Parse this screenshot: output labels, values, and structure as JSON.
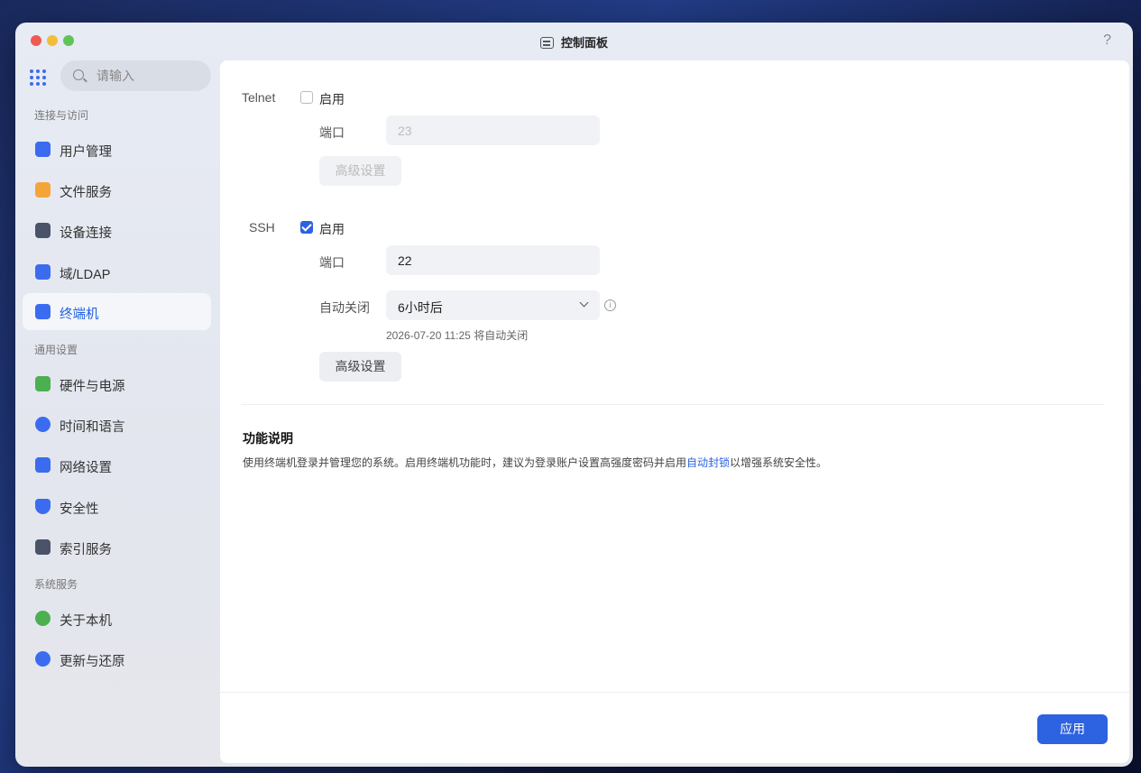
{
  "window": {
    "title": "控制面板",
    "help": "?"
  },
  "sidebar": {
    "search_placeholder": "请输入",
    "sections": [
      {
        "label": "连接与访问",
        "items": [
          {
            "label": "用户管理",
            "icon": "user-icon",
            "color": "#3b6cf0"
          },
          {
            "label": "文件服务",
            "icon": "folder-icon",
            "color": "#f3a53a"
          },
          {
            "label": "设备连接",
            "icon": "device-icon",
            "color": "#4a5368"
          },
          {
            "label": "域/LDAP",
            "icon": "ldap-icon",
            "color": "#3b6cf0"
          },
          {
            "label": "终端机",
            "icon": "terminal-icon",
            "color": "#3b6cf0",
            "active": true
          }
        ]
      },
      {
        "label": "通用设置",
        "items": [
          {
            "label": "硬件与电源",
            "icon": "power-icon",
            "color": "#4caf50"
          },
          {
            "label": "时间和语言",
            "icon": "globe-icon",
            "color": "#3b6cf0"
          },
          {
            "label": "网络设置",
            "icon": "network-icon",
            "color": "#3b6cf0"
          },
          {
            "label": "安全性",
            "icon": "shield-icon",
            "color": "#3b6cf0"
          },
          {
            "label": "索引服务",
            "icon": "index-icon",
            "color": "#4a5368"
          }
        ]
      },
      {
        "label": "系统服务",
        "items": [
          {
            "label": "关于本机",
            "icon": "info-icon",
            "color": "#4caf50"
          },
          {
            "label": "更新与还原",
            "icon": "update-icon",
            "color": "#3b6cf0"
          }
        ]
      }
    ]
  },
  "telnet": {
    "label": "Telnet",
    "enable_label": "启用",
    "enabled": false,
    "port_label": "端口",
    "port_placeholder": "23",
    "advanced_label": "高级设置"
  },
  "ssh": {
    "label": "SSH",
    "enable_label": "启用",
    "enabled": true,
    "port_label": "端口",
    "port_value": "22",
    "auto_close_label": "自动关闭",
    "auto_close_value": "6小时后",
    "auto_close_note": "2026-07-20 11:25 将自动关闭",
    "advanced_label": "高级设置"
  },
  "description": {
    "title": "功能说明",
    "text_before": "使用终端机登录并管理您的系统。启用终端机功能时，建议为登录账户设置高强度密码并启用",
    "link": "自动封锁",
    "text_after": "以增强系统安全性。"
  },
  "footer": {
    "apply_label": "应用"
  },
  "colors": {
    "accent": "#2d62e0"
  }
}
